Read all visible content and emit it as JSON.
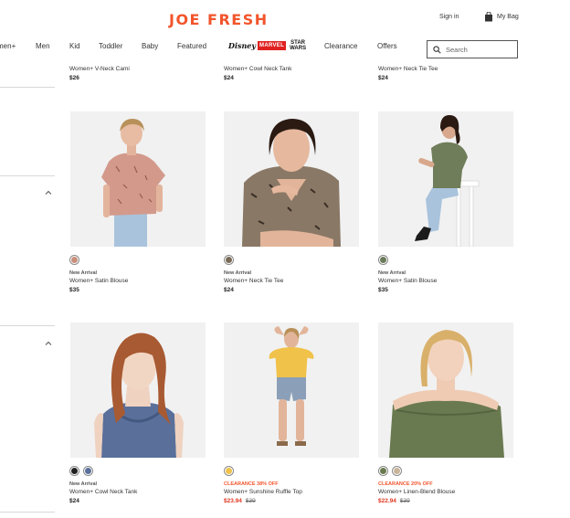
{
  "header": {
    "logo": "JOE FRESH",
    "sign_in": "Sign in",
    "bag": "My Bag"
  },
  "nav": {
    "items": [
      "men+",
      "Men",
      "Kid",
      "Toddler",
      "Baby",
      "Featured",
      "Clearance",
      "Offers"
    ],
    "brands": {
      "disney": "Disney",
      "marvel": "MARVEL",
      "star_wars": "STAR WARS"
    }
  },
  "search": {
    "placeholder": "Search"
  },
  "top_row": [
    {
      "name": "Women+ V-Neck Cami",
      "price": "$26"
    },
    {
      "name": "Women+ Cowl Neck Tank",
      "price": "$24"
    },
    {
      "name": "Women+ Neck Tie Tee",
      "price": "$24"
    }
  ],
  "products": [
    {
      "badge": "New Arrival",
      "name": "Women+ Satin Blouse",
      "price": "$35",
      "swatches": [
        "#c98e7a"
      ]
    },
    {
      "badge": "New Arrival",
      "name": "Women+ Neck Tie Tee",
      "price": "$24",
      "swatches": [
        "#7a6a58"
      ]
    },
    {
      "badge": "New Arrival",
      "name": "Women+ Satin Blouse",
      "price": "$35",
      "swatches": [
        "#6b7a5a"
      ]
    },
    {
      "badge": "New Arrival",
      "name": "Women+ Cowl Neck Tank",
      "price": "$24",
      "swatches": [
        "#222222",
        "#5a6f9a"
      ]
    },
    {
      "badge": "CLEARANCE 38% OFF",
      "name": "Women+ Sunshine Ruffle Top",
      "price_sale": "$23.94",
      "price_was": "$39",
      "swatches": [
        "#f0c24a"
      ]
    },
    {
      "badge": "CLEARANCE 20% OFF",
      "name": "Women+ Linen-Blend Blouse",
      "price_sale": "$22.94",
      "price_was": "$39",
      "swatches": [
        "#6a7a50",
        "#c8b49a"
      ]
    }
  ],
  "colors": {
    "brand": "#f2552c",
    "sale": "#e0351f"
  },
  "icons": {
    "bag": "shopping-bag-icon",
    "search": "search-icon",
    "chevron": "chevron-up-icon"
  }
}
